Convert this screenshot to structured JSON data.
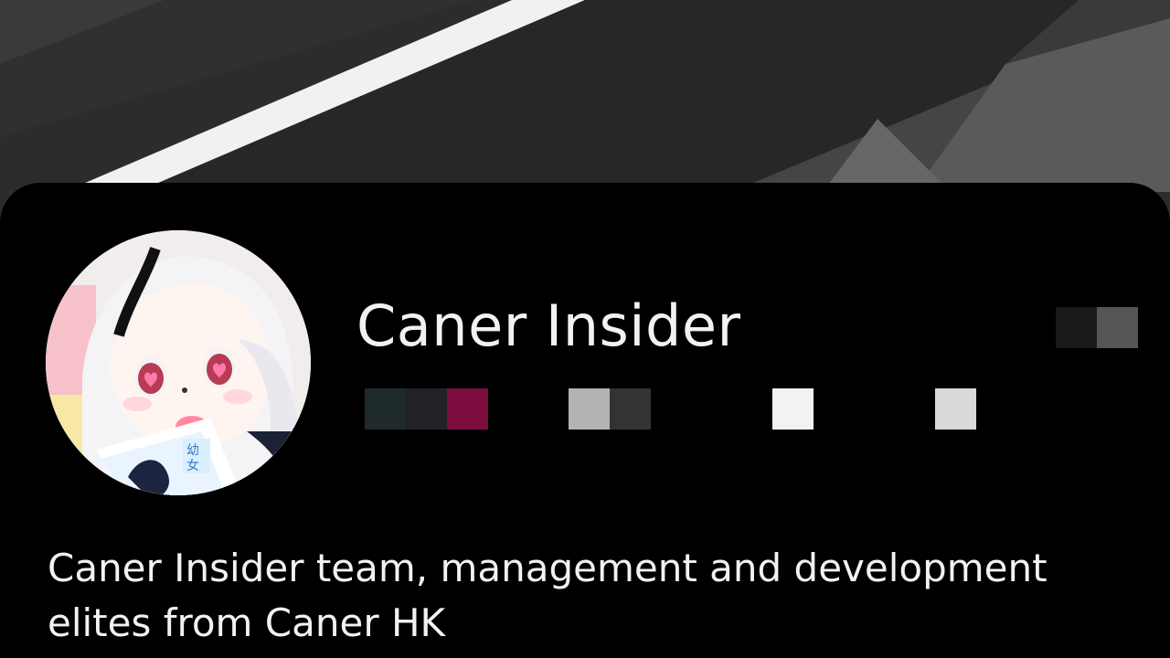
{
  "profile": {
    "name": "Caner Insider",
    "bio": "Caner Insider team, management and development elites from Caner HK"
  },
  "censored": {
    "top_right": [
      "#1a1a1a",
      "#555555"
    ],
    "stat_1": [
      "#1f2a2a",
      "#222126",
      "#7a0d3e"
    ],
    "stat_2": [
      "#b3b3b3",
      "#333333"
    ],
    "stat_3": [
      "#f2f2f2"
    ],
    "stat_4": [
      "#d9d9d9"
    ]
  },
  "avatar_book_text": "幼女"
}
